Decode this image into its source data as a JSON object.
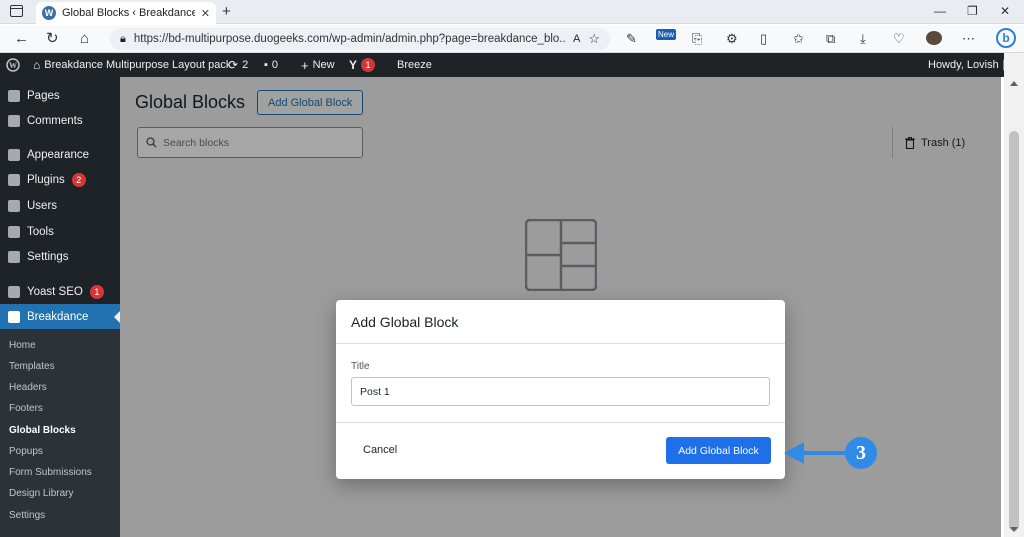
{
  "browser": {
    "tab_title": "Global Blocks ‹ Breakdance Multi",
    "url": "https://bd-multipurpose.duogeeks.com/wp-admin/admin.php?page=breakdance_blo...",
    "new_badge": "New"
  },
  "admin_bar": {
    "site_name": "Breakdance Multipurpose Layout pack",
    "updates_count": "2",
    "comments_count": "0",
    "new_label": "New",
    "yoast_count": "1",
    "breeze_label": "Breeze",
    "howdy": "Howdy, Lovish"
  },
  "sidebar": {
    "items": [
      {
        "label": "Pages",
        "icon": "pages-icon"
      },
      {
        "label": "Comments",
        "icon": "comments-icon"
      },
      {
        "label": "Appearance",
        "icon": "appearance-icon"
      },
      {
        "label": "Plugins",
        "icon": "plugins-icon",
        "badge": "2"
      },
      {
        "label": "Users",
        "icon": "users-icon"
      },
      {
        "label": "Tools",
        "icon": "tools-icon"
      },
      {
        "label": "Settings",
        "icon": "settings-icon"
      },
      {
        "label": "Yoast SEO",
        "icon": "yoast-icon",
        "badge": "1"
      },
      {
        "label": "Breakdance",
        "icon": "breakdance-icon"
      }
    ],
    "submenu": [
      "Home",
      "Templates",
      "Headers",
      "Footers",
      "Global Blocks",
      "Popups",
      "Form Submissions",
      "Design Library",
      "Settings"
    ]
  },
  "main": {
    "title": "Global Blocks",
    "add_button": "Add Global Block",
    "search_placeholder": "Search blocks",
    "trash_label": "Trash (1)"
  },
  "modal": {
    "title": "Add Global Block",
    "field_label": "Title",
    "field_value": "Post 1",
    "cancel": "Cancel",
    "submit": "Add Global Block"
  },
  "annotation": {
    "step": "3"
  },
  "colors": {
    "primary": "#1e6fe8",
    "admin_bar": "#1d2327",
    "active_menu": "#2271b1",
    "badge": "#d63638",
    "callout": "#2f8be6"
  }
}
